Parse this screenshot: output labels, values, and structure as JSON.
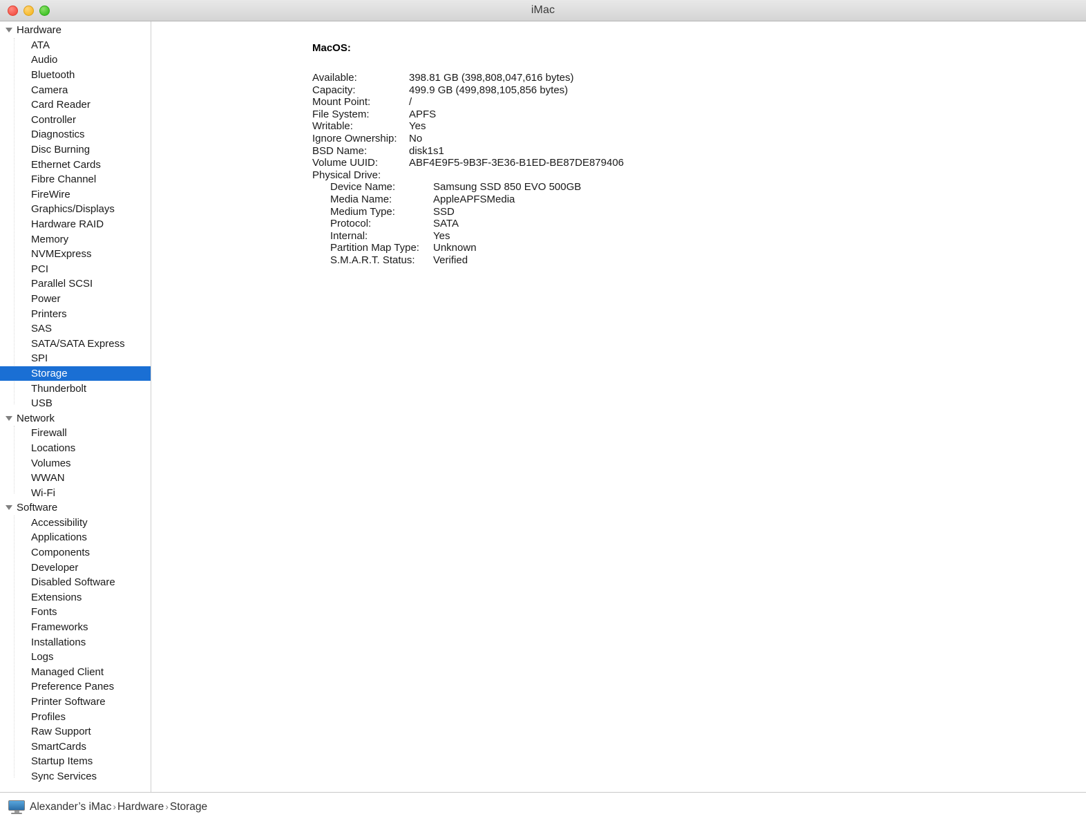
{
  "window": {
    "title": "iMac",
    "controls": {
      "close": "close-button",
      "minimize": "minimize-button",
      "maximize": "maximize-button"
    }
  },
  "sidebar": {
    "groups": [
      {
        "label": "Hardware",
        "expanded": true,
        "items": [
          "ATA",
          "Audio",
          "Bluetooth",
          "Camera",
          "Card Reader",
          "Controller",
          "Diagnostics",
          "Disc Burning",
          "Ethernet Cards",
          "Fibre Channel",
          "FireWire",
          "Graphics/Displays",
          "Hardware RAID",
          "Memory",
          "NVMExpress",
          "PCI",
          "Parallel SCSI",
          "Power",
          "Printers",
          "SAS",
          "SATA/SATA Express",
          "SPI",
          "Storage",
          "Thunderbolt",
          "USB"
        ],
        "selected": "Storage"
      },
      {
        "label": "Network",
        "expanded": true,
        "items": [
          "Firewall",
          "Locations",
          "Volumes",
          "WWAN",
          "Wi-Fi"
        ],
        "selected": null
      },
      {
        "label": "Software",
        "expanded": true,
        "items": [
          "Accessibility",
          "Applications",
          "Components",
          "Developer",
          "Disabled Software",
          "Extensions",
          "Fonts",
          "Frameworks",
          "Installations",
          "Logs",
          "Managed Client",
          "Preference Panes",
          "Printer Software",
          "Profiles",
          "Raw Support",
          "SmartCards",
          "Startup Items",
          "Sync Services"
        ],
        "selected": null
      }
    ]
  },
  "content": {
    "section_title": "MacOS:",
    "details": [
      {
        "key": "Available:",
        "value": "398.81 GB (398,808,047,616 bytes)"
      },
      {
        "key": "Capacity:",
        "value": "499.9 GB (499,898,105,856 bytes)"
      },
      {
        "key": "Mount Point:",
        "value": "/"
      },
      {
        "key": "File System:",
        "value": "APFS"
      },
      {
        "key": "Writable:",
        "value": "Yes"
      },
      {
        "key": "Ignore Ownership:",
        "value": "No"
      },
      {
        "key": "BSD Name:",
        "value": "disk1s1"
      },
      {
        "key": "Volume UUID:",
        "value": "ABF4E9F5-9B3F-3E36-B1ED-BE87DE879406"
      }
    ],
    "physical_drive": {
      "key": "Physical Drive:",
      "details": [
        {
          "key": "Device Name:",
          "value": "Samsung SSD 850 EVO 500GB"
        },
        {
          "key": "Media Name:",
          "value": "AppleAPFSMedia"
        },
        {
          "key": "Medium Type:",
          "value": "SSD"
        },
        {
          "key": "Protocol:",
          "value": "SATA"
        },
        {
          "key": "Internal:",
          "value": "Yes"
        },
        {
          "key": "Partition Map Type:",
          "value": "Unknown"
        },
        {
          "key": "S.M.A.R.T. Status:",
          "value": "Verified"
        }
      ]
    }
  },
  "statusbar": {
    "icon": "imac-computer-icon",
    "crumbs": [
      "Alexander’s iMac",
      "Hardware",
      "Storage"
    ],
    "separator": "›"
  },
  "colors": {
    "selection_blue": "#1a6fd4",
    "selection_text": "#ffffff",
    "titlebar_top": "#e8e8e8",
    "titlebar_bottom": "#d4d4d4",
    "close_red": "#f4564b",
    "minimize_yellow": "#f6bc2f",
    "maximize_green": "#45c52b"
  }
}
